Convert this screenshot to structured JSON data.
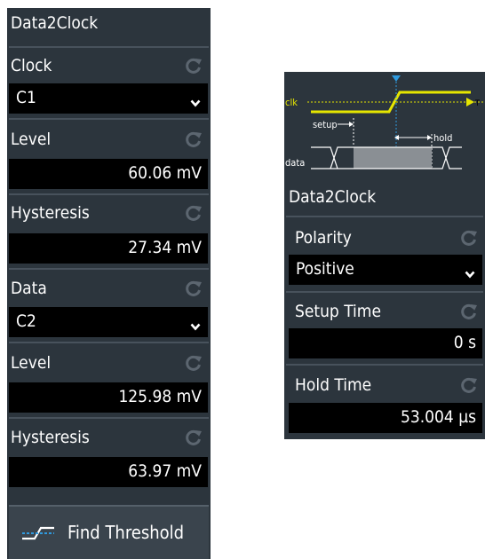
{
  "left_panel": {
    "title": "Data2Clock",
    "clock": {
      "label": "Clock",
      "source": "C1",
      "level_label": "Level",
      "level": "60.06 mV",
      "hysteresis_label": "Hysteresis",
      "hysteresis": "27.34 mV"
    },
    "data": {
      "label": "Data",
      "source": "C2",
      "level_label": "Level",
      "level": "125.98 mV",
      "hysteresis_label": "Hysteresis",
      "hysteresis": "63.97 mV"
    },
    "find_threshold_label": "Find Threshold"
  },
  "right_panel": {
    "diagram": {
      "clk_label": "clk",
      "setup_label": "setup",
      "hold_label": "hold",
      "data_label": "data",
      "trigger_marker": "T"
    },
    "title": "Data2Clock",
    "polarity_label": "Polarity",
    "polarity_value": "Positive",
    "setup_time_label": "Setup Time",
    "setup_time_value": "0 s",
    "hold_time_label": "Hold Time",
    "hold_time_value": "53.004 µs"
  },
  "colors": {
    "panel_bg": "#2c353d",
    "field_bg": "#000000",
    "divider": "#48525c",
    "clock_trace": "#e6e600",
    "reset_icon": "#5c6670",
    "cursor": "#2f9be0"
  },
  "icons": {
    "reset": "reset-icon",
    "dropdown": "chevron-down-icon",
    "find_threshold": "threshold-icon"
  }
}
